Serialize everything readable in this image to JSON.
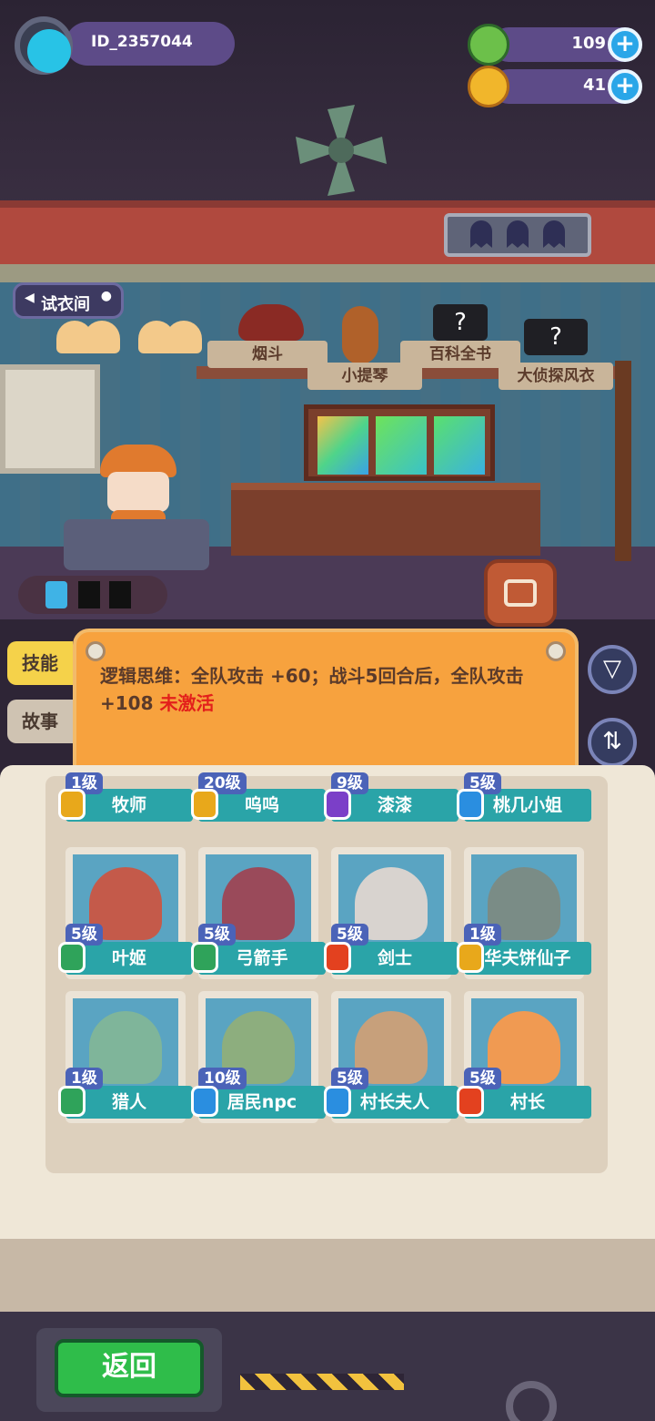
{
  "player": {
    "id": "ID_2357044"
  },
  "currencies": [
    {
      "icon": "green-gem-icon",
      "value": "109"
    },
    {
      "icon": "gold-planet-coin-icon",
      "value": "41"
    }
  ],
  "room": {
    "title": "试衣间",
    "shelf_items": [
      "烟斗",
      "小提琴",
      "百科全书",
      "大侦探风衣"
    ]
  },
  "tabs": {
    "skill": "技能",
    "story": "故事"
  },
  "skill": {
    "text": "逻辑思维：全队攻击 +60；战斗5回合后，全队攻击 +108 ",
    "status": "未激活"
  },
  "characters_top": [
    {
      "level": "1级",
      "name": "牧师",
      "badge": "#e8a81b"
    },
    {
      "level": "20级",
      "name": "呜呜",
      "badge": "#e8a81b"
    },
    {
      "level": "9级",
      "name": "漆漆",
      "badge": "#7b3fc8"
    },
    {
      "level": "5级",
      "name": "桃几小姐",
      "badge": "#2a8ee0"
    }
  ],
  "characters_mid": [
    {
      "level": "5级",
      "name": "叶姬",
      "badge": "#2fa35a"
    },
    {
      "level": "5级",
      "name": "弓箭手",
      "badge": "#2fa35a"
    },
    {
      "level": "5级",
      "name": "剑士",
      "badge": "#e3411f"
    },
    {
      "level": "1级",
      "name": "华夫饼仙子",
      "badge": "#e8a81b"
    }
  ],
  "characters_bottom": [
    {
      "level": "1级",
      "name": "猎人",
      "badge": "#2fa35a"
    },
    {
      "level": "10级",
      "name": "居民npc",
      "badge": "#2a8ee0"
    },
    {
      "level": "5级",
      "name": "村长夫人",
      "badge": "#2a8ee0"
    },
    {
      "level": "5级",
      "name": "村长",
      "badge": "#e3411f"
    }
  ],
  "buttons": {
    "back": "返回"
  }
}
